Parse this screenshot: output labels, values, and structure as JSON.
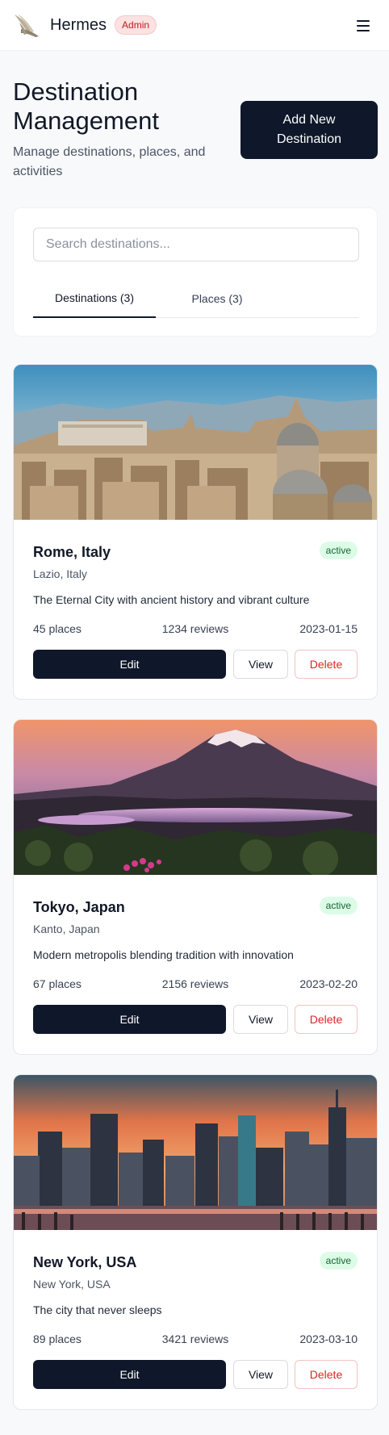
{
  "header": {
    "brand": "Hermes",
    "role_badge": "Admin",
    "logo_icon": "winged-logo-icon",
    "menu_icon": "hamburger-menu-icon"
  },
  "page": {
    "title": "Destination Management",
    "subtitle": "Manage destinations, places, and activities",
    "add_button": "Add New Destination"
  },
  "search": {
    "placeholder": "Search destinations...",
    "value": ""
  },
  "tabs": [
    {
      "label": "Destinations (3)",
      "active": true
    },
    {
      "label": "Places (3)",
      "active": false
    }
  ],
  "destinations": [
    {
      "name": "Rome, Italy",
      "region": "Lazio, Italy",
      "status": "active",
      "description": "The Eternal City with ancient history and vibrant culture",
      "places": "45 places",
      "reviews": "1234 reviews",
      "date": "2023-01-15",
      "image": "rome-skyline-photo"
    },
    {
      "name": "Tokyo, Japan",
      "region": "Kanto, Japan",
      "status": "active",
      "description": "Modern metropolis blending tradition with innovation",
      "places": "67 places",
      "reviews": "2156 reviews",
      "date": "2023-02-20",
      "image": "mount-fuji-photo"
    },
    {
      "name": "New York, USA",
      "region": "New York, USA",
      "status": "active",
      "description": "The city that never sleeps",
      "places": "89 places",
      "reviews": "3421 reviews",
      "date": "2023-03-10",
      "image": "manhattan-skyline-photo"
    }
  ],
  "actions": {
    "edit": "Edit",
    "view": "View",
    "delete": "Delete"
  },
  "colors": {
    "primary": "#0f172a",
    "background": "#f8f9fb",
    "danger": "#dc2626",
    "active_badge_bg": "#dcfce7",
    "active_badge_text": "#166534",
    "admin_badge_bg": "#fde2e2"
  }
}
